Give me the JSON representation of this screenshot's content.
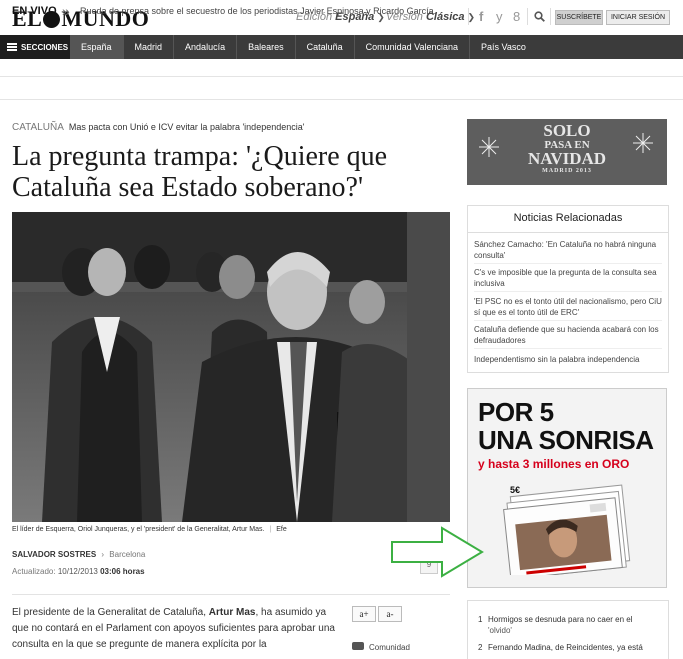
{
  "header": {
    "logo_left": "EL",
    "logo_right": "MUNDO",
    "edition_label": "Edición",
    "edition_value": "España",
    "version_label": "Versión",
    "version_value": "Clásica",
    "social": [
      "f",
      "y",
      "8"
    ],
    "search_icon": "search-icon",
    "subscribe_label": "SUSCRÍBETE",
    "login_label": "INICIAR SESIÓN"
  },
  "nav": {
    "sections_label": "SECCIONES",
    "items": [
      {
        "label": "España",
        "active": true
      },
      {
        "label": "Madrid"
      },
      {
        "label": "Andalucía"
      },
      {
        "label": "Baleares"
      },
      {
        "label": "Cataluña"
      },
      {
        "label": "Comunidad Valenciana"
      },
      {
        "label": "País Vasco"
      }
    ]
  },
  "live": {
    "label": "EN VIVO",
    "separator": "»",
    "text": "Rueda de prensa sobre el secuestro de los periodistas Javier Espinosa y Ricardo García."
  },
  "article": {
    "section": "CATALUÑA",
    "kicker": "Mas pacta con Unió e ICV evitar la palabra 'independencia'",
    "headline": "La pregunta trampa: '¿Quiere que Cataluña sea Estado soberano?'",
    "caption": "El líder de Esquerra, Oriol Junqueras, y el 'president' de la Generalitat, Artur Mas.",
    "caption_credit": "Efe",
    "author": "SALVADOR SOSTRES",
    "location": "Barcelona",
    "updated_label": "Actualizado:",
    "updated_date": "10/12/2013",
    "updated_time": "03:06 horas",
    "body_pre": "El presidente de la Generalitat de Cataluña, ",
    "body_bold": "Artur Mas",
    "body_post": ", ha asumido ya que no contará en el Parlament con apoyos suficientes para aprobar una consulta en la que se pregunte de manera explícita por la",
    "font_increase": "a+",
    "font_decrease": "a-",
    "community_label": "Comunidad",
    "share_label": "9"
  },
  "ad_top": {
    "line1": "SOLO",
    "line2": "PASA EN",
    "line3": "NAVIDAD",
    "line4": "MADRID 2013"
  },
  "related": {
    "title": "Noticias Relacionadas",
    "items": [
      "Sánchez Camacho: 'En Cataluña no habrá ninguna consulta'",
      "C's ve imposible que la pregunta de la consulta sea inclusiva",
      "'El PSC no es el tonto útil del nacionalismo, pero CiU sí que es el tonto útil de ERC'",
      "Cataluña defiende que su hacienda acabará con los defraudadores",
      "Independentismo sin la palabra independencia"
    ]
  },
  "ad_lottery": {
    "line1": "POR 5",
    "line2": "UNA SONRISA",
    "line3": "y hasta 3 millones en ORO",
    "ticket_price": "5€"
  },
  "most_read": {
    "items": [
      {
        "n": "1",
        "text": "Hormigos se desnuda para no caer en el",
        "text2": "'olvido'"
      },
      {
        "n": "2",
        "text": "Fernando Madina, de Reincidentes, ya está"
      }
    ]
  },
  "colors": {
    "nav_bg": "#3b3b3b",
    "arrow": "#3cb043",
    "ad_red": "#d6001c"
  }
}
